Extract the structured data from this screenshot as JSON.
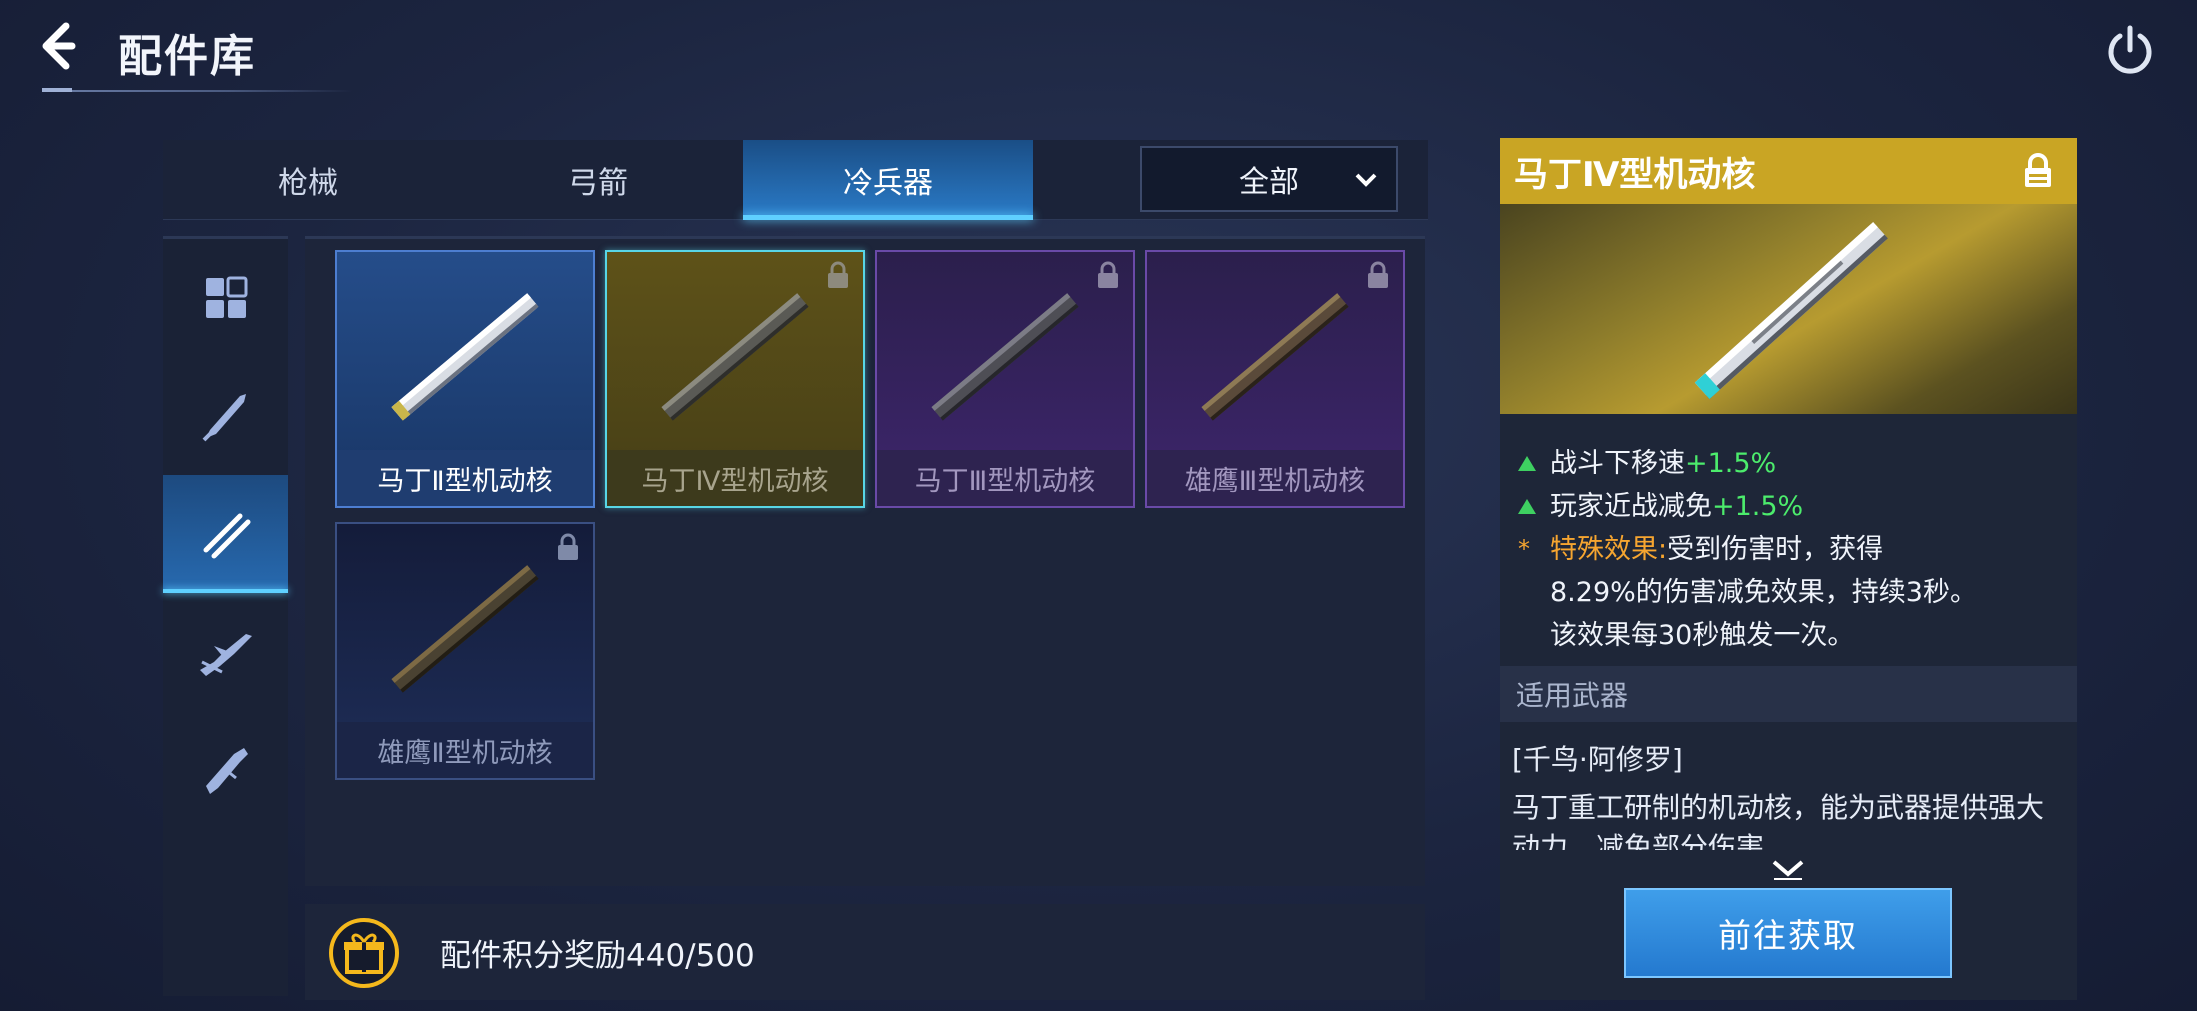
{
  "header": {
    "title": "配件库",
    "back_icon": "back-arrow-icon",
    "power_icon": "power-icon"
  },
  "tabs": [
    {
      "label": "枪械",
      "active": false
    },
    {
      "label": "弓箭",
      "active": false
    },
    {
      "label": "冷兵器",
      "active": true
    }
  ],
  "filter": {
    "selected": "全部"
  },
  "categories": [
    {
      "icon": "all-grid-icon",
      "active": false
    },
    {
      "icon": "blade-icon",
      "active": false
    },
    {
      "icon": "mobile-core-icon",
      "active": true
    },
    {
      "icon": "gun-barrel-icon",
      "active": false
    },
    {
      "icon": "stock-icon",
      "active": false
    }
  ],
  "items": [
    {
      "name": "马丁Ⅱ型机动核",
      "rarity": "blue",
      "locked": false
    },
    {
      "name": "马丁Ⅳ型机动核",
      "rarity": "gold",
      "locked": true,
      "selected": true
    },
    {
      "name": "马丁Ⅲ型机动核",
      "rarity": "purple",
      "locked": true
    },
    {
      "name": "雄鹰Ⅲ型机动核",
      "rarity": "purple",
      "locked": true
    },
    {
      "name": "雄鹰Ⅱ型机动核",
      "rarity": "navy",
      "locked": true
    }
  ],
  "reward": {
    "text": "配件积分奖励440/500"
  },
  "detail": {
    "title": "马丁Ⅳ型机动核",
    "stat1_label": "战斗下移速",
    "stat1_value": "+1.5%",
    "stat2_label": "玩家近战减免",
    "stat2_value": "+1.5%",
    "special_marker": "*",
    "special_label": "特殊效果:",
    "special_line1": "受到伤害时，获得",
    "special_line2": "8.29%的伤害减免效果，持续3秒。",
    "special_line3": "该效果每30秒触发一次。",
    "section_title": "适用武器",
    "weapon": "[千鸟·阿修罗]",
    "description": "马丁重工研制的机动核，能为武器提供强大动力，减免部分伤害",
    "button": "前往获取"
  },
  "colors": {
    "accent_blue": "#2b7cc9",
    "highlight_cyan": "#5fd0ff",
    "gold": "#c9a524",
    "stat_green": "#4cec6c",
    "special_orange": "#f6a530"
  }
}
